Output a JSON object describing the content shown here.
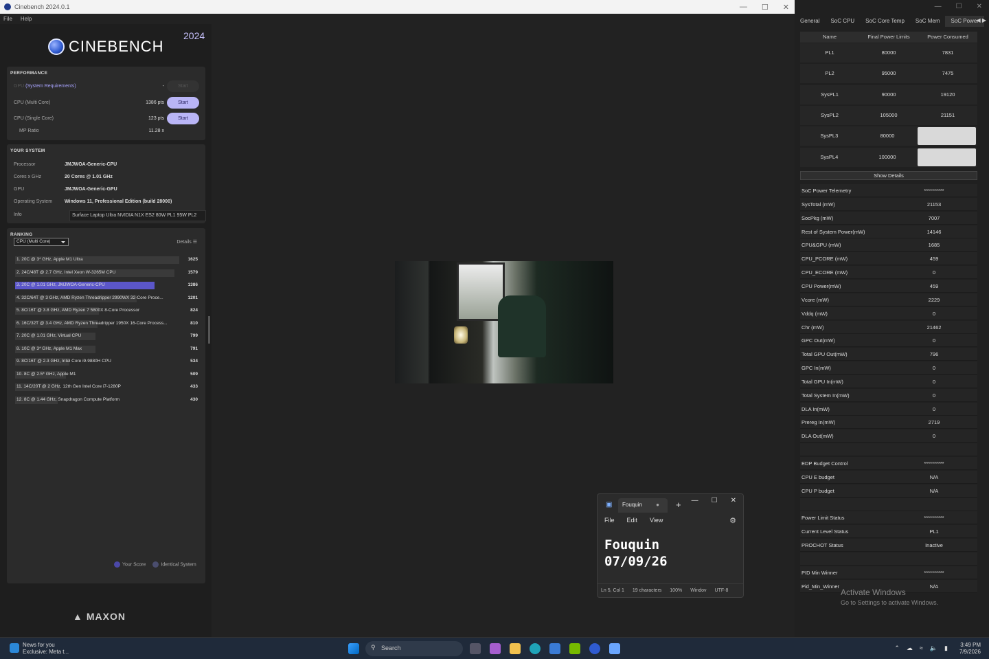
{
  "window": {
    "title": "Cinebench 2024.0.1",
    "menu": [
      "File",
      "Help"
    ]
  },
  "logo": {
    "text": "CINEBENCH",
    "year": "2024"
  },
  "performance": {
    "title": "PERFORMANCE",
    "gpu_label": "GPU",
    "gpu_link": "(System Requirements)",
    "gpu_pts": "-",
    "cpu_multi_label": "CPU (Multi Core)",
    "cpu_multi_pts": "1386 pts",
    "cpu_single_label": "CPU (Single Core)",
    "cpu_single_pts": "123 pts",
    "mp_label": "MP Ratio",
    "mp_value": "11.28 x",
    "start": "Start"
  },
  "system": {
    "title": "YOUR SYSTEM",
    "rows": [
      {
        "k": "Processor",
        "v": "JMJWOA-Generic-CPU"
      },
      {
        "k": "Cores x GHz",
        "v": "20 Cores @ 1.01 GHz"
      },
      {
        "k": "GPU",
        "v": "JMJWOA-Generic-GPU"
      },
      {
        "k": "Operating System",
        "v": "Windows 11, Professional Edition (build 28000)"
      }
    ],
    "info_label": "Info",
    "info_value": "Surface Laptop Ultra NVIDIA N1X ES2 80W PL1 95W PL2"
  },
  "ranking": {
    "title": "RANKING",
    "select": "CPU (Multi Core)",
    "details": "Details",
    "your_score": "Your Score",
    "identical": "Identical System",
    "rows": [
      {
        "label": "1. 20C @ 3* GHz, Apple M1 Ultra",
        "score": "1625",
        "frac": 1.0
      },
      {
        "label": "2. 24C/48T @ 2.7 GHz, Intel Xeon W-3265M CPU",
        "score": "1579",
        "frac": 0.97
      },
      {
        "label": "3. 20C @ 1.01 GHz, JMJWOA-Generic-CPU",
        "score": "1386",
        "frac": 0.85
      },
      {
        "label": "4. 32C/64T @ 3 GHz, AMD Ryzen Threadripper 2990WX 32-Core Proce...",
        "score": "1201",
        "frac": 0.74
      },
      {
        "label": "5. 8C/16T @ 3.8 GHz, AMD Ryzen 7 5800X 8-Core Processor",
        "score": "824",
        "frac": 0.51
      },
      {
        "label": "6. 16C/32T @ 3.4 GHz, AMD Ryzen Threadripper 1950X 16-Core Process...",
        "score": "810",
        "frac": 0.5
      },
      {
        "label": "7. 20C @ 1.01 GHz, Virtual CPU",
        "score": "799",
        "frac": 0.49
      },
      {
        "label": "8. 10C @ 3* GHz, Apple M1 Max",
        "score": "791",
        "frac": 0.49
      },
      {
        "label": "9. 8C/16T @ 2.3 GHz, Intel Core i9-9880H CPU",
        "score": "534",
        "frac": 0.33
      },
      {
        "label": "10. 8C @ 2.5* GHz, Apple M1",
        "score": "509",
        "frac": 0.31
      },
      {
        "label": "11. 14C/20T @ 2 GHz, 12th Gen Intel Core i7-1280P",
        "score": "433",
        "frac": 0.27
      },
      {
        "label": "12. 8C @ 1.44 GHz, Snapdragon Compute Platform",
        "score": "430",
        "frac": 0.26
      }
    ]
  },
  "maxon": "MAXON",
  "hw": {
    "tabs": [
      "General",
      "SoC CPU",
      "SoC Core Temp",
      "SoC Mem",
      "SoC Power"
    ],
    "pl_headers": [
      "Name",
      "Final Power Limits",
      "Power Consumed"
    ],
    "pl_rows": [
      [
        "PL1",
        "80000",
        "7831"
      ],
      [
        "PL2",
        "95000",
        "7475"
      ],
      [
        "SysPL1",
        "90000",
        "19120"
      ],
      [
        "SysPL2",
        "105000",
        "21151"
      ],
      [
        "SysPL3",
        "80000",
        ""
      ],
      [
        "SysPL4",
        "100000",
        ""
      ]
    ],
    "show_details": "Show Details",
    "telemetry": [
      [
        "SoC Power Telemetry",
        "**********"
      ],
      [
        "SysTotal (mW)",
        "21153"
      ],
      [
        "SocPkg (mW)",
        "7007"
      ],
      [
        "Rest of System Power(mW)",
        "14146"
      ],
      [
        "CPU&GPU (mW)",
        "1685"
      ],
      [
        "CPU_PCORE (mW)",
        "459"
      ],
      [
        "CPU_ECORE (mW)",
        "0"
      ],
      [
        "CPU Power(mW)",
        "459"
      ],
      [
        "Vcore (mW)",
        "2229"
      ],
      [
        "Vddq (mW)",
        "0"
      ],
      [
        "Chr (mW)",
        "21462"
      ],
      [
        "GPC Out(mW)",
        "0"
      ],
      [
        "Total GPU Out(mW)",
        "796"
      ],
      [
        "GPC In(mW)",
        "0"
      ],
      [
        "Total GPU In(mW)",
        "0"
      ],
      [
        "Total System In(mW)",
        "0"
      ],
      [
        "DLA In(mW)",
        "0"
      ],
      [
        "Prereg In(mW)",
        "2719"
      ],
      [
        "DLA Out(mW)",
        "0"
      ],
      [
        "",
        ""
      ],
      [
        "EDP Budget Control",
        "**********"
      ],
      [
        "CPU E budget",
        "N/A"
      ],
      [
        "CPU P budget",
        "N/A"
      ],
      [
        "",
        ""
      ],
      [
        "Power Limit Status",
        "**********"
      ],
      [
        "Current Level Status",
        "PL1"
      ],
      [
        "PROCHOT Status",
        "Inactive"
      ],
      [
        "",
        ""
      ],
      [
        "PID Min Winner",
        "**********"
      ],
      [
        "Pid_Min_Winner",
        "N/A"
      ]
    ],
    "activate_title": "Activate Windows",
    "activate_sub": "Go to Settings to activate Windows."
  },
  "notepad": {
    "tab": "Fouquin",
    "menu": [
      "File",
      "Edit",
      "View"
    ],
    "line1": "Fouquin",
    "line2": "07/09/26",
    "status": [
      "Ln 5, Col 1",
      "19 characters",
      "100%",
      "Windov",
      "UTF-8"
    ]
  },
  "taskbar": {
    "news_title": "News for you",
    "news_sub": "Exclusive: Meta t...",
    "search": "Search",
    "time": "3:49 PM",
    "date": "7/9/2026"
  }
}
